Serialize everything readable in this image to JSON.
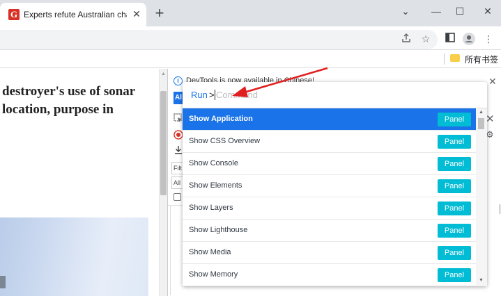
{
  "browser": {
    "tab": {
      "favicon_letter": "G",
      "title": "Experts refute Australian char"
    },
    "window_controls": {
      "tab_search": "⌄",
      "minimize": "—",
      "maximize": "☐",
      "close": "✕"
    },
    "toolbar": {
      "share_icon": "share-icon",
      "star_icon": "star-icon",
      "sidepanel_icon": "side-panel-icon",
      "profile_icon": "profile-icon",
      "menu_icon": "menu-icon"
    },
    "bookmarks": {
      "folder_label": "所有书签"
    }
  },
  "page": {
    "article_lines": [
      "destroyer's use of sonar",
      "location, purpose in"
    ]
  },
  "devtools": {
    "info_text": "DevTools is now available in Chinese!",
    "blue_button": "Al",
    "filter_text": "Filt",
    "levels_text": "All"
  },
  "command_menu": {
    "prompt_run": "Run",
    "prompt_gt": ">",
    "placeholder": "Command",
    "items": [
      {
        "label": "Show Application",
        "badge": "Panel"
      },
      {
        "label": "Show CSS Overview",
        "badge": "Panel"
      },
      {
        "label": "Show Console",
        "badge": "Panel"
      },
      {
        "label": "Show Elements",
        "badge": "Panel"
      },
      {
        "label": "Show Layers",
        "badge": "Panel"
      },
      {
        "label": "Show Lighthouse",
        "badge": "Panel"
      },
      {
        "label": "Show Media",
        "badge": "Panel"
      },
      {
        "label": "Show Memory",
        "badge": "Panel"
      }
    ],
    "selected_index": 0
  },
  "colors": {
    "accent": "#1a73e8",
    "badge": "#00bcd4",
    "annotation_arrow": "#e02020"
  }
}
